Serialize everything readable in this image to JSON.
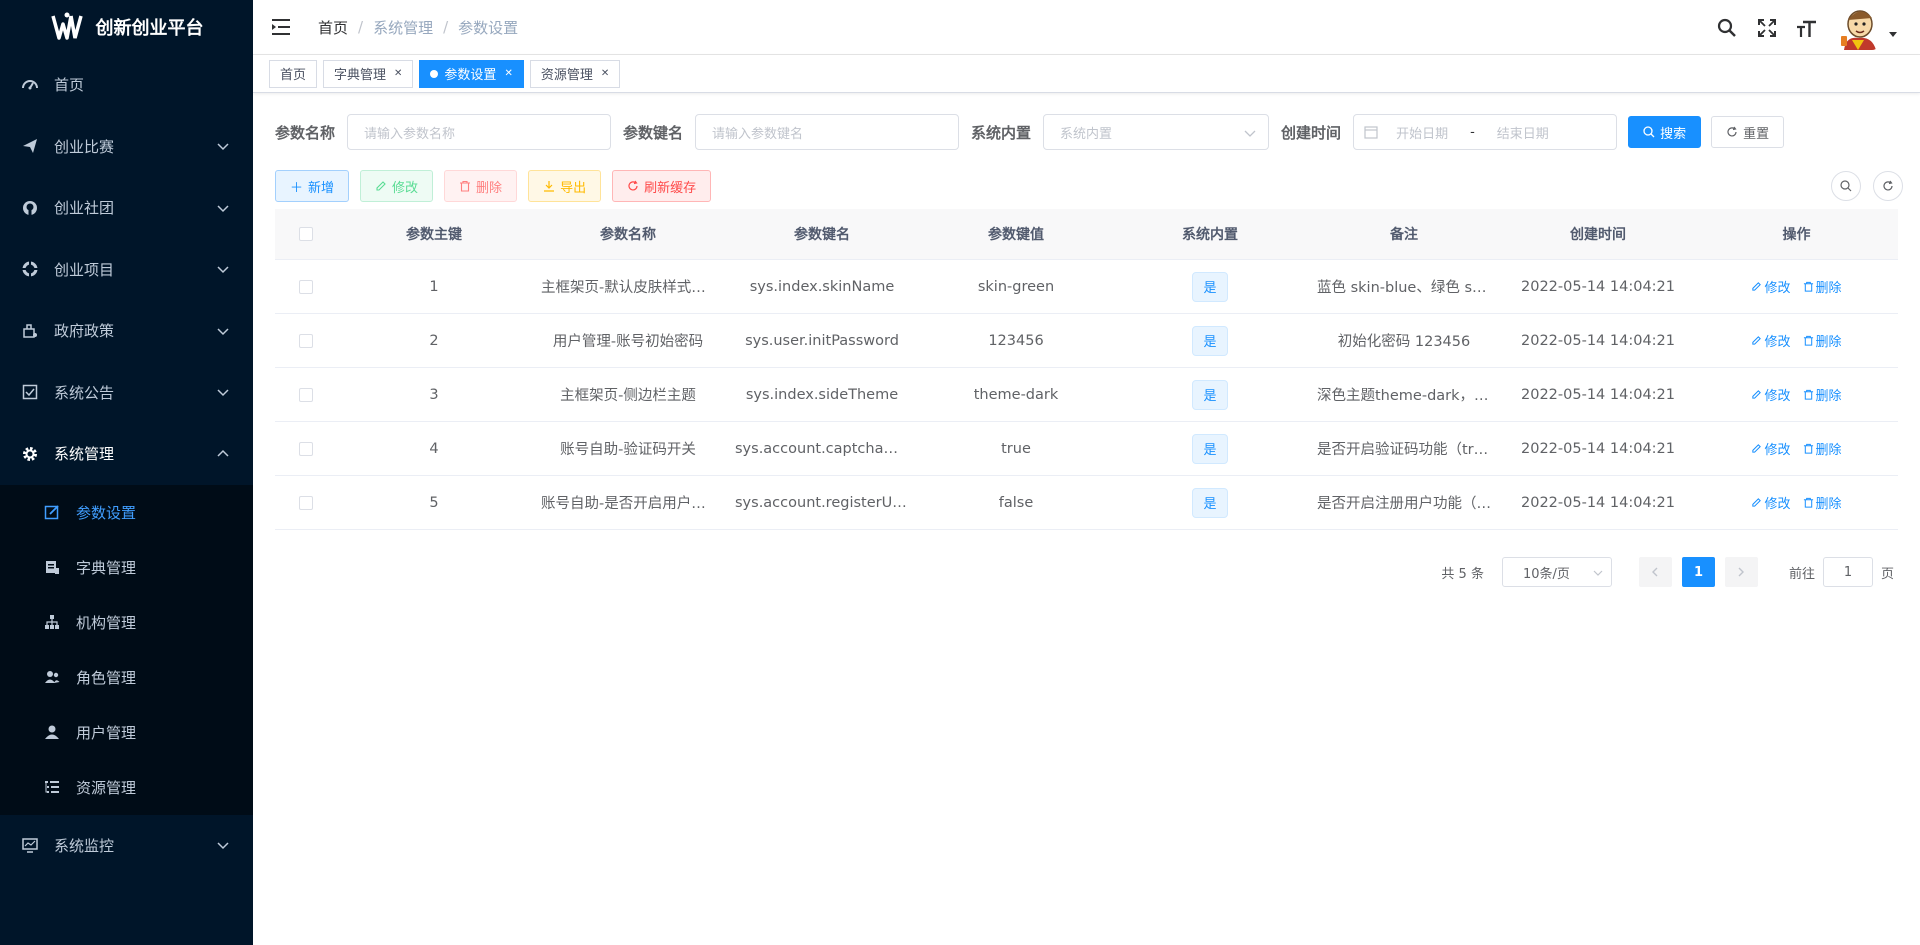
{
  "app": {
    "title": "创新创业平台"
  },
  "sidebar": {
    "items": [
      {
        "label": "首页",
        "icon": "dashboard-icon"
      },
      {
        "label": "创业比赛",
        "icon": "send-icon"
      },
      {
        "label": "创业社团",
        "icon": "github-icon"
      },
      {
        "label": "创业项目",
        "icon": "bug-icon"
      },
      {
        "label": "政府政策",
        "icon": "build-icon"
      },
      {
        "label": "系统公告",
        "icon": "checkbox-icon"
      },
      {
        "label": "系统管理",
        "icon": "gear-icon"
      }
    ],
    "sub_items": [
      {
        "label": "参数设置",
        "icon": "edit-icon"
      },
      {
        "label": "字典管理",
        "icon": "dict-icon"
      },
      {
        "label": "机构管理",
        "icon": "tree-icon"
      },
      {
        "label": "角色管理",
        "icon": "peoples-icon"
      },
      {
        "label": "用户管理",
        "icon": "user-icon"
      },
      {
        "label": "资源管理",
        "icon": "tree-table-icon"
      }
    ],
    "bottom_item": {
      "label": "系统监控",
      "icon": "monitor-icon"
    }
  },
  "breadcrumb": [
    "首页",
    "系统管理",
    "参数设置"
  ],
  "tags": [
    {
      "label": "首页",
      "closable": false
    },
    {
      "label": "字典管理",
      "closable": true
    },
    {
      "label": "参数设置",
      "closable": true,
      "active": true
    },
    {
      "label": "资源管理",
      "closable": true
    }
  ],
  "search": {
    "name_label": "参数名称",
    "name_placeholder": "请输入参数名称",
    "key_label": "参数键名",
    "key_placeholder": "请输入参数键名",
    "type_label": "系统内置",
    "type_placeholder": "系统内置",
    "time_label": "创建时间",
    "start_placeholder": "开始日期",
    "range_sep": "-",
    "end_placeholder": "结束日期",
    "search_btn": "搜索",
    "reset_btn": "重置"
  },
  "toolbar": {
    "add": "新增",
    "edit": "修改",
    "delete": "删除",
    "export": "导出",
    "refresh_cache": "刷新缓存"
  },
  "table": {
    "headers": [
      "参数主键",
      "参数名称",
      "参数键名",
      "参数键值",
      "系统内置",
      "备注",
      "创建时间",
      "操作"
    ],
    "rows": [
      {
        "id": "1",
        "name": "主框架页-默认皮肤样式名称",
        "key": "sys.index.skinName",
        "value": "skin-green",
        "builtin": "是",
        "remark": "蓝色 skin-blue、绿色 skin-green",
        "time": "2022-05-14 14:04:21"
      },
      {
        "id": "2",
        "name": "用户管理-账号初始密码",
        "key": "sys.user.initPassword",
        "value": "123456",
        "builtin": "是",
        "remark": "初始化密码 123456",
        "time": "2022-05-14 14:04:21"
      },
      {
        "id": "3",
        "name": "主框架页-侧边栏主题",
        "key": "sys.index.sideTheme",
        "value": "theme-dark",
        "builtin": "是",
        "remark": "深色主题theme-dark，浅色主题theme-light",
        "time": "2022-05-14 14:04:21"
      },
      {
        "id": "4",
        "name": "账号自助-验证码开关",
        "key": "sys.account.captchaOnOff",
        "value": "true",
        "builtin": "是",
        "remark": "是否开启验证码功能（true开启，false关闭）",
        "time": "2022-05-14 14:04:21"
      },
      {
        "id": "5",
        "name": "账号自助-是否开启用户注册功能",
        "key": "sys.account.registerUser",
        "value": "false",
        "builtin": "是",
        "remark": "是否开启注册用户功能（true开启，false关闭）",
        "time": "2022-05-14 14:04:21"
      }
    ],
    "op_edit": "修改",
    "op_delete": "删除"
  },
  "pagination": {
    "total": "共 5 条",
    "page_size": "10条/页",
    "current": "1",
    "goto_label": "前往",
    "goto_value": "1",
    "page_suffix": "页"
  },
  "colors": {
    "sidebar_bg": "#001529",
    "primary": "#1890ff"
  }
}
